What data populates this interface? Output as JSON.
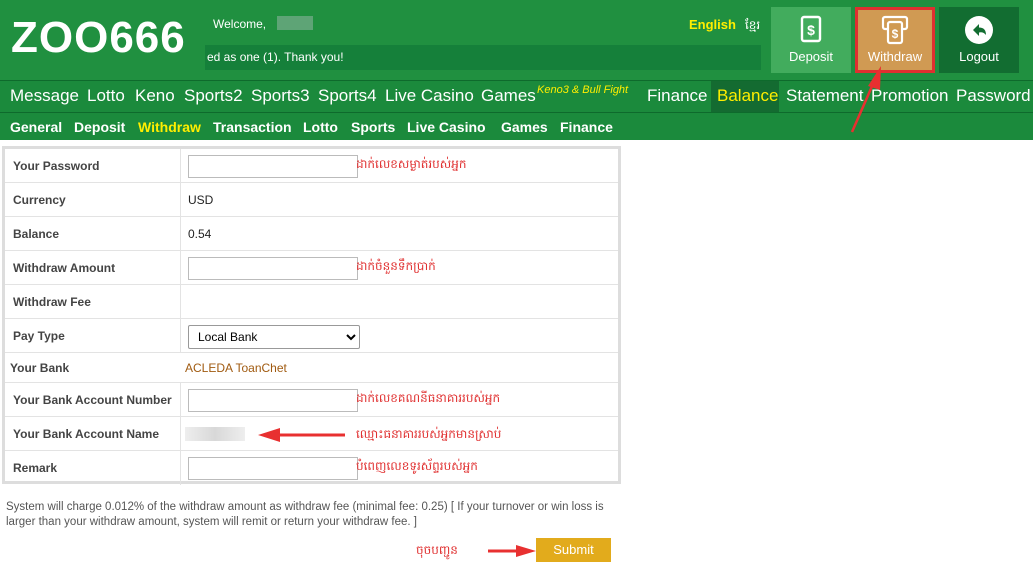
{
  "header": {
    "logo": "ZOO666",
    "welcome": "Welcome,",
    "marquee": "ed as one (1). Thank you!",
    "lang_english": "English",
    "lang_khmer": "ខ្មែរ",
    "buttons": {
      "deposit": "Deposit",
      "withdraw": "Withdraw",
      "logout": "Logout"
    }
  },
  "nav": {
    "items": [
      "Message",
      "Lotto",
      "Keno",
      "Sports2",
      "Sports3",
      "Sports4",
      "Live Casino",
      "Games",
      "Finance",
      "Balance",
      "Statement",
      "Promotion",
      "Password"
    ],
    "badge": "Keno3 & Bull Fight"
  },
  "subnav": {
    "items": [
      "General",
      "Deposit",
      "Withdraw",
      "Transaction",
      "Lotto",
      "Sports",
      "Live Casino",
      "Games",
      "Finance"
    ],
    "active": "Withdraw"
  },
  "form": {
    "password_label": "Your Password",
    "currency_label": "Currency",
    "currency_value": "USD",
    "balance_label": "Balance",
    "balance_value": "0.54",
    "amount_label": "Withdraw Amount",
    "fee_label": "Withdraw Fee",
    "paytype_label": "Pay Type",
    "paytype_value": "Local Bank",
    "bank_label": "Your Bank",
    "bank_value": "ACLEDA ToanChet",
    "account_number_label": "Your Bank Account Number",
    "account_name_label": "Your Bank Account Name",
    "remark_label": "Remark"
  },
  "notes": {
    "password": "ដាក់លេខសម្ងាត់របស់អ្នក",
    "amount": "ដាក់ចំនួនទឹកប្រាក់",
    "account_number": "ដាក់លេខគណនីធនាគាររបស់អ្នក",
    "account_name": "ឈ្មោះធនាគាររបស់អ្នកមានស្រាប់",
    "remark": "បំពេញលេខទូរស័ព្ទរបស់អ្នក",
    "submit": "ចុចបញ្ជូន"
  },
  "footer_text": "System will charge 0.012% of the withdraw amount as withdraw fee (minimal fee: 0.25) [ If your turnover or win loss is larger than your withdraw amount, system will remit or return your withdraw fee. ]",
  "submit_label": "Submit",
  "colors": {
    "header_green": "#209040",
    "accent_yellow": "#ffee00",
    "annotation_red": "#e03030",
    "submit_gold": "#e2ab1c"
  }
}
